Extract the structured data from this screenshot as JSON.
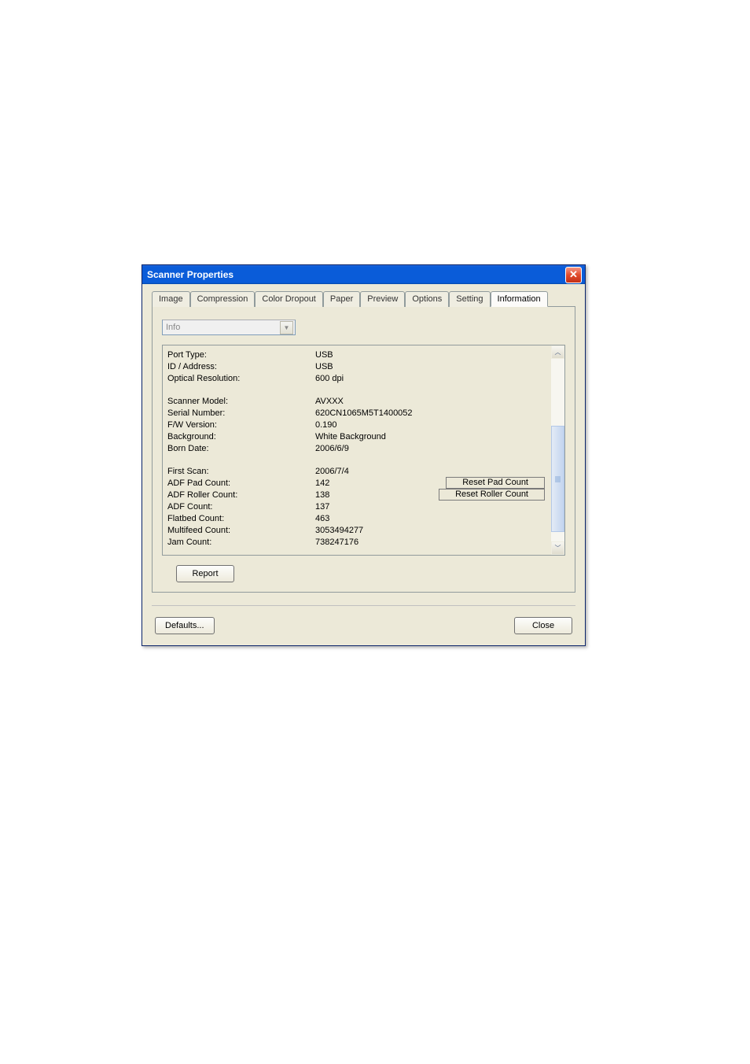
{
  "window": {
    "title": "Scanner Properties",
    "close_label": "✕"
  },
  "tabs": {
    "image": "Image",
    "compression": "Compression",
    "color_dropout": "Color Dropout",
    "paper": "Paper",
    "preview": "Preview",
    "options": "Options",
    "setting": "Setting",
    "information": "Information"
  },
  "dropdown": {
    "value": "Info",
    "arrow": "▼"
  },
  "info": {
    "port_type": {
      "label": "Port Type:",
      "value": "USB"
    },
    "id_address": {
      "label": "ID / Address:",
      "value": "USB"
    },
    "optical_resolution": {
      "label": "Optical Resolution:",
      "value": "600 dpi"
    },
    "scanner_model": {
      "label": "Scanner Model:",
      "value": "AVXXX"
    },
    "serial_number": {
      "label": "Serial Number:",
      "value": "620CN1065M5T1400052"
    },
    "fw_version": {
      "label": "F/W Version:",
      "value": "0.190"
    },
    "background": {
      "label": "Background:",
      "value": "White Background"
    },
    "born_date": {
      "label": "Born Date:",
      "value": "2006/6/9"
    },
    "first_scan": {
      "label": "First Scan:",
      "value": "2006/7/4"
    },
    "adf_pad_count": {
      "label": "ADF Pad Count:",
      "value": "142",
      "action": "Reset Pad Count"
    },
    "adf_roller_count": {
      "label": "ADF Roller Count:",
      "value": "138",
      "action": "Reset Roller Count"
    },
    "adf_count": {
      "label": "ADF Count:",
      "value": "137"
    },
    "flatbed_count": {
      "label": "Flatbed Count:",
      "value": "463"
    },
    "multifeed_count": {
      "label": "Multifeed Count:",
      "value": "3053494277"
    },
    "jam_count": {
      "label": "Jam Count:",
      "value": "738247176"
    }
  },
  "buttons": {
    "report": "Report",
    "defaults": "Defaults...",
    "close": "Close"
  },
  "scroll": {
    "up": "︿",
    "down": "﹀"
  }
}
